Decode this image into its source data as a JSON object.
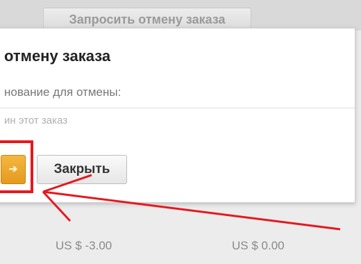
{
  "background": {
    "request_cancel_label": "Запросить отмену заказа"
  },
  "modal": {
    "title": "отмену заказа",
    "reason_label": "нование для отмены:",
    "reason_text": "ин этот заказ",
    "confirm_icon": "arrow-right-icon",
    "close_label": "Закрыть"
  },
  "prices": [
    "US $ -3.00",
    "US $ 0.00"
  ],
  "annotation": {
    "color": "#e5181e",
    "shapes": [
      "highlight-box",
      "arrow"
    ]
  },
  "colors": {
    "confirm_button": "#f0a92e",
    "annotation": "#e5181e"
  }
}
